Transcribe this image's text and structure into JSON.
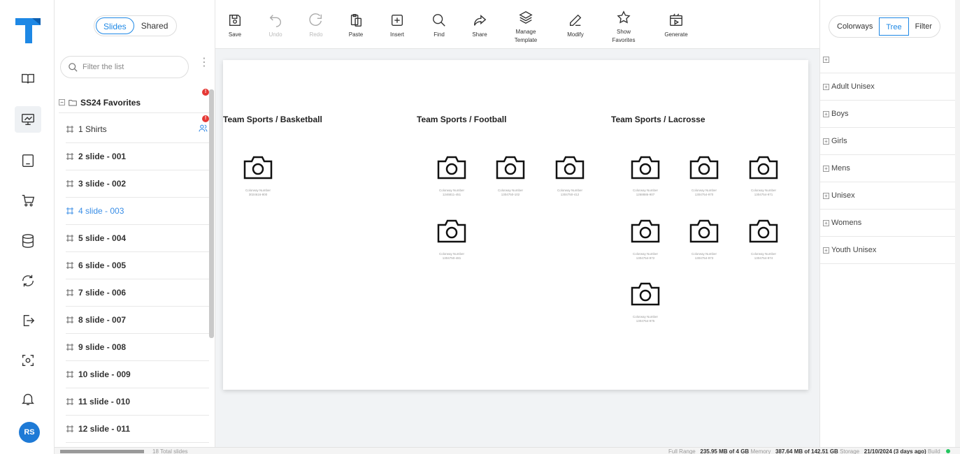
{
  "rail": {
    "avatar_initials": "RS",
    "icons": [
      "book-icon",
      "presentation-icon",
      "tablet-icon",
      "cart-icon",
      "database-icon",
      "sync-icon",
      "export-icon",
      "scan-icon",
      "bell-icon"
    ]
  },
  "list": {
    "tabs": [
      "Slides",
      "Shared"
    ],
    "active_tab": "Slides",
    "filter_placeholder": "Filter the list",
    "folder_name": "SS24 Favorites",
    "folder_badge": "!",
    "slides": [
      {
        "label": "1 Shirts"
      },
      {
        "label": "2 slide - 001"
      },
      {
        "label": "3 slide - 002"
      },
      {
        "label": "4 slide - 003"
      },
      {
        "label": "5 slide - 004"
      },
      {
        "label": "6 slide - 005"
      },
      {
        "label": "7 slide - 006"
      },
      {
        "label": "8 slide - 007"
      },
      {
        "label": "9 slide - 008"
      },
      {
        "label": "10 slide - 009"
      },
      {
        "label": "11 slide - 010"
      },
      {
        "label": "12 slide - 011"
      }
    ],
    "active_slide": "4 slide - 003"
  },
  "toolbar": {
    "save": "Save",
    "undo": "Undo",
    "redo": "Redo",
    "paste": "Paste",
    "insert": "Insert",
    "find": "Find",
    "share": "Share",
    "manage_template": "Manage Template",
    "modify": "Modify",
    "show_favorites": "Show Favorites",
    "generate": "Generate"
  },
  "canvas": {
    "groups": [
      {
        "title": "Team Sports / Basketball",
        "captions": [
          "Colorway Number\n3024616-800"
        ]
      },
      {
        "title": "Team Sports / Football",
        "captions": [
          "Colorway Number\n1246811-451",
          "Colorway Number\n1304750-102",
          "Colorway Number\n1304750-412",
          "Colorway Number\n1304750-481"
        ]
      },
      {
        "title": "Team Sports / Lacrosse",
        "captions": [
          "Colorway Number\n1268886-907",
          "Colorway Number\n1304754-970",
          "Colorway Number\n1304754-971",
          "Colorway Number\n1304754-972",
          "Colorway Number\n1304754-973",
          "Colorway Number\n1304754-974",
          "Colorway Number\n1304754-975"
        ]
      }
    ]
  },
  "right": {
    "tabs": [
      "Colorways",
      "Tree",
      "Filter"
    ],
    "active_tab": "Tree",
    "tree": [
      "Adult Unisex",
      "Boys",
      "Girls",
      "Mens",
      "Unisex",
      "Womens",
      "Youth Unisex"
    ]
  },
  "status": {
    "total": "18 Total slides",
    "range": "Full Range",
    "memory_value": "235.95 MB of 4 GB",
    "memory_label": "Memory",
    "storage_value": "387.64 MB of 142.51 GB",
    "storage_label": "Storage",
    "build_value": "21/10/2024 (3 days ago)",
    "build_label": "Build"
  },
  "colors": {
    "accent": "#1e88e5",
    "logo": "#1e88e5",
    "badge": "#e53935",
    "online": "#22c55e"
  }
}
